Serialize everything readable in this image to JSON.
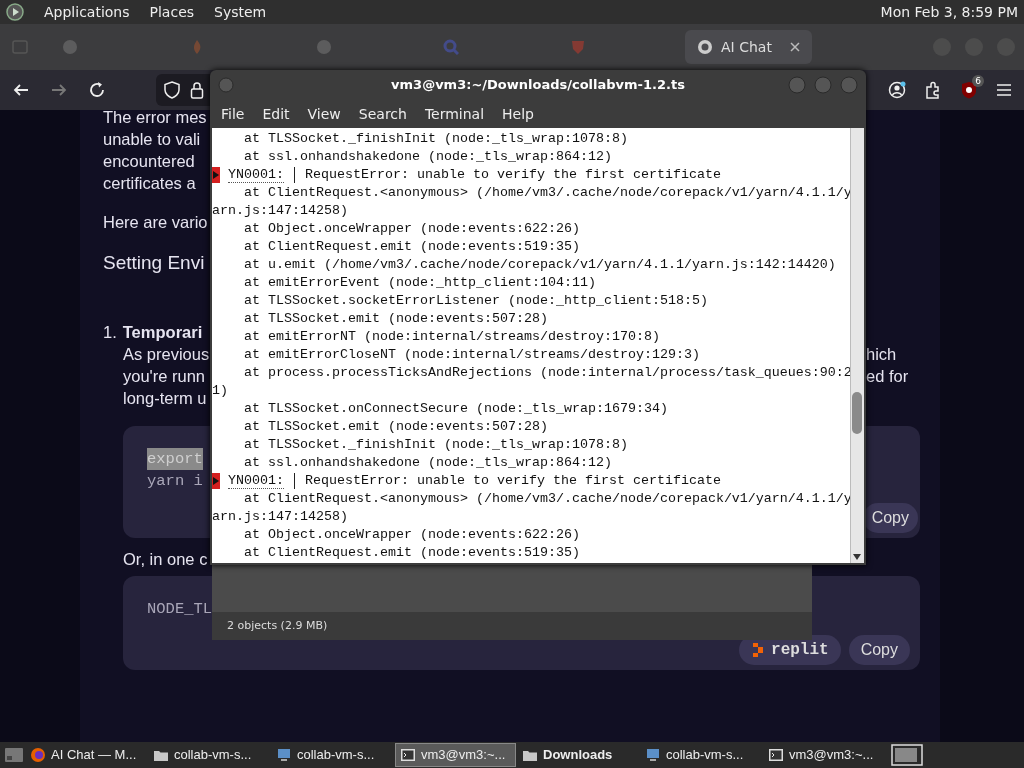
{
  "top_panel": {
    "menus": [
      "Applications",
      "Places",
      "System"
    ],
    "clock": "Mon Feb 3, 8:59 PM"
  },
  "browser": {
    "tabs": [
      {
        "kind": "round",
        "selected": false
      },
      {
        "kind": "flame",
        "selected": false
      },
      {
        "kind": "round",
        "selected": false
      },
      {
        "kind": "search",
        "selected": false
      },
      {
        "kind": "shield",
        "selected": false
      },
      {
        "kind": "chat",
        "label": "AI Chat",
        "selected": true
      }
    ],
    "back": {
      "disabled": false
    },
    "forward": {
      "disabled": true
    },
    "extension_badge": "6",
    "content": {
      "intro_lines": [
        "The error mes",
        "unable to vali",
        "encountered",
        "certificates a"
      ],
      "lead": "Here are vario",
      "heading": "Setting Envi",
      "list_item": {
        "number": "1.",
        "title": "Temporari",
        "lines": [
          {
            "left": "As previous",
            "right": "hich"
          },
          {
            "left": "you're runn",
            "right": "ed for"
          },
          {
            "left": "long-term u"
          }
        ]
      },
      "code_block_1": {
        "lines": [
          {
            "text": "export",
            "selected": true
          },
          {
            "text": "yarn i",
            "selected": false
          }
        ],
        "copy": "Copy"
      },
      "between": "Or, in one c",
      "code_block_2": {
        "lines": [
          {
            "text": "NODE_TL",
            "selected": false
          }
        ],
        "run_button": "replit",
        "copy": "Copy"
      }
    }
  },
  "terminal": {
    "title": "vm3@vm3:~/Downloads/collabvm-1.2.ts",
    "menu": [
      "File",
      "Edit",
      "View",
      "Search",
      "Terminal",
      "Help"
    ],
    "lines": [
      {
        "kind": "frame",
        "text": "at TLSSocket._finishInit (node:_tls_wrap:1078:8)"
      },
      {
        "kind": "frame",
        "text": "at ssl.onhandshakedone (node:_tls_wrap:864:12)"
      },
      {
        "kind": "error",
        "code": "YN0001:",
        "text": "RequestError: unable to verify the first certificate"
      },
      {
        "kind": "frame",
        "text": "at ClientRequest.<anonymous> (/home/vm3/.cache/node/corepack/v1/yarn/4.1.1/y"
      },
      {
        "kind": "continuation",
        "text": "arn.js:147:14258)"
      },
      {
        "kind": "frame",
        "text": "at Object.onceWrapper (node:events:622:26)"
      },
      {
        "kind": "frame",
        "text": "at ClientRequest.emit (node:events:519:35)"
      },
      {
        "kind": "frame",
        "text": "at u.emit (/home/vm3/.cache/node/corepack/v1/yarn/4.1.1/yarn.js:142:14420)"
      },
      {
        "kind": "frame",
        "text": "at emitErrorEvent (node:_http_client:104:11)"
      },
      {
        "kind": "frame",
        "text": "at TLSSocket.socketErrorListener (node:_http_client:518:5)"
      },
      {
        "kind": "frame",
        "text": "at TLSSocket.emit (node:events:507:28)"
      },
      {
        "kind": "frame",
        "text": "at emitErrorNT (node:internal/streams/destroy:170:8)"
      },
      {
        "kind": "frame",
        "text": "at emitErrorCloseNT (node:internal/streams/destroy:129:3)"
      },
      {
        "kind": "frame",
        "text": "at process.processTicksAndRejections (node:internal/process/task_queues:90:2"
      },
      {
        "kind": "continuation",
        "text": "1)"
      },
      {
        "kind": "frame",
        "text": "at TLSSocket.onConnectSecure (node:_tls_wrap:1679:34)"
      },
      {
        "kind": "frame",
        "text": "at TLSSocket.emit (node:events:507:28)"
      },
      {
        "kind": "frame",
        "text": "at TLSSocket._finishInit (node:_tls_wrap:1078:8)"
      },
      {
        "kind": "frame",
        "text": "at ssl.onhandshakedone (node:_tls_wrap:864:12)"
      },
      {
        "kind": "error",
        "code": "YN0001:",
        "text": "RequestError: unable to verify the first certificate"
      },
      {
        "kind": "frame",
        "text": "at ClientRequest.<anonymous> (/home/vm3/.cache/node/corepack/v1/yarn/4.1.1/y"
      },
      {
        "kind": "continuation",
        "text": "arn.js:147:14258)"
      },
      {
        "kind": "frame",
        "text": "at Object.onceWrapper (node:events:622:26)"
      },
      {
        "kind": "frame",
        "text": "at ClientRequest.emit (node:events:519:35)"
      }
    ]
  },
  "file_manager": {
    "status": "2 objects (2.9 MB)"
  },
  "taskbar": {
    "items": [
      {
        "kind": "browser",
        "label": "AI Chat — M...",
        "selected": false,
        "emphasized": false
      },
      {
        "kind": "folder",
        "label": "collab-vm-s...",
        "selected": false,
        "emphasized": false
      },
      {
        "kind": "network",
        "label": "collab-vm-s...",
        "selected": false,
        "emphasized": false
      },
      {
        "kind": "terminal",
        "label": "vm3@vm3:~...",
        "selected": true,
        "emphasized": false
      },
      {
        "kind": "folder",
        "label": "Downloads",
        "selected": false,
        "emphasized": true
      },
      {
        "kind": "network",
        "label": "collab-vm-s...",
        "selected": false,
        "emphasized": false
      },
      {
        "kind": "terminal",
        "label": "vm3@vm3:~...",
        "selected": false,
        "emphasized": false
      }
    ]
  }
}
